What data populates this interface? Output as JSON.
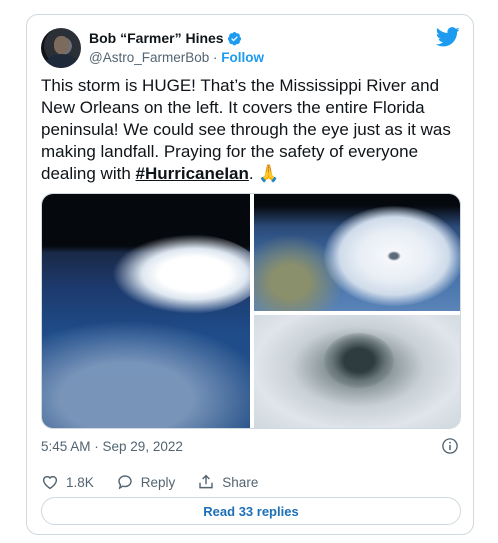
{
  "tweet": {
    "author": {
      "name": "Bob “Farmer” Hines",
      "handle": "@Astro_FarmerBob",
      "separator": "·",
      "follow_label": "Follow",
      "avatar_icon": "avatar-photo",
      "verified_icon": "verified-badge-icon"
    },
    "brand_icon": "twitter-bird-icon",
    "text_main": "This storm is HUGE!  That’s the Mississippi River and New Orleans on the left. It covers the entire Florida peninsula!  We could see through the eye just as it was making landfall. Praying for the safety of everyone dealing with ",
    "hashtag": "#HurricaneIan",
    "text_end": ". 🙏",
    "media": [
      {
        "type": "photo",
        "icon": "hurricane-from-orbit-photo"
      },
      {
        "type": "photo",
        "icon": "hurricane-eye-wide-photo"
      },
      {
        "type": "photo",
        "icon": "hurricane-eye-closeup-photo"
      }
    ],
    "timestamp": "5:45 AM · Sep 29, 2022",
    "actions": {
      "likes": "1.8K",
      "reply_label": "Reply",
      "share_label": "Share"
    },
    "read_replies_label": "Read 33 replies"
  },
  "colors": {
    "brand": "#1d9bf0",
    "text": "#0f1419",
    "muted": "#536471",
    "border": "#cfd9de"
  }
}
